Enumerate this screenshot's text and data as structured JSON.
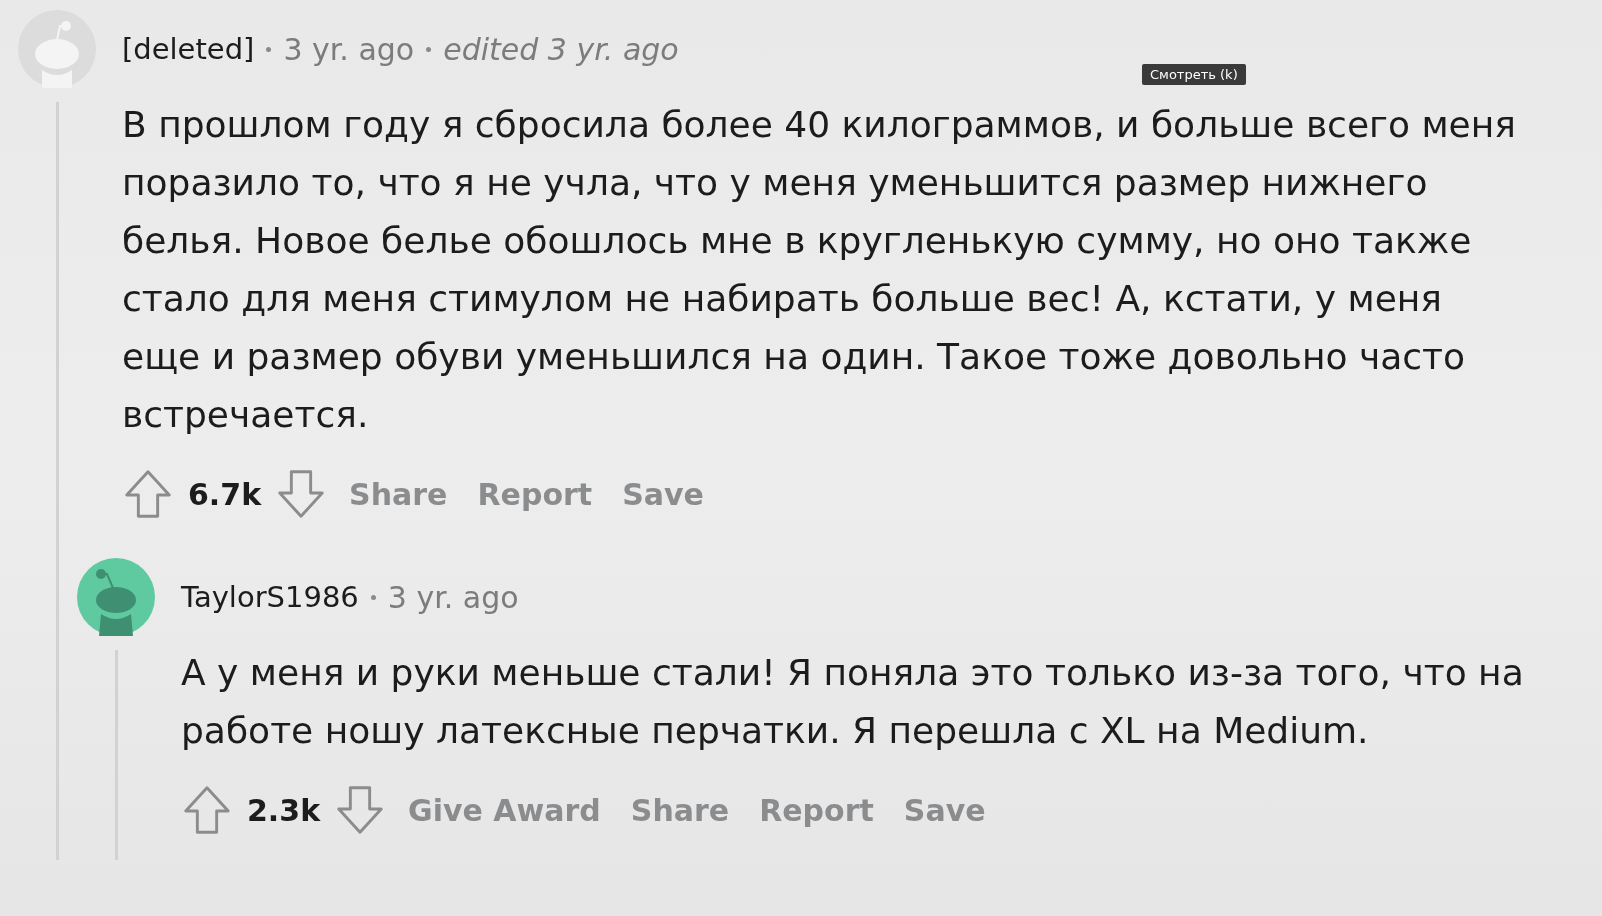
{
  "comments": [
    {
      "author": "[deleted]",
      "avatar": {
        "kind": "deleted"
      },
      "meta": [
        {
          "text": "3 yr. ago",
          "kind": "time"
        },
        {
          "text": "edited 3 yr. ago",
          "kind": "edited"
        }
      ],
      "text": "В прошлом году я сбросила более 40 килограммов, и больше всего меня поразило то, что я не учла, что у меня уменьшится размер нижнего белья. Новое белье обошлось мне в кругленькую сумму, но оно также стало для меня стимулом не набирать больше вес! А, кстати, у меня еще и размер обуви уменьшился на один. Такое тоже довольно часто встречается.",
      "score": "6.7k",
      "actions": [
        "Share",
        "Report",
        "Save"
      ],
      "tooltip": "Смотреть (k)",
      "replies": [
        {
          "author": "TaylorS1986",
          "avatar": {
            "kind": "user"
          },
          "meta": [
            {
              "text": "3 yr. ago",
              "kind": "time"
            }
          ],
          "text": "А у меня и руки меньше стали! Я поняла это только из-за того, что на работе ношу латексные перчатки. Я перешла с XL на Medium.",
          "score": "2.3k",
          "actions": [
            "Give Award",
            "Share",
            "Report",
            "Save"
          ]
        }
      ]
    }
  ]
}
